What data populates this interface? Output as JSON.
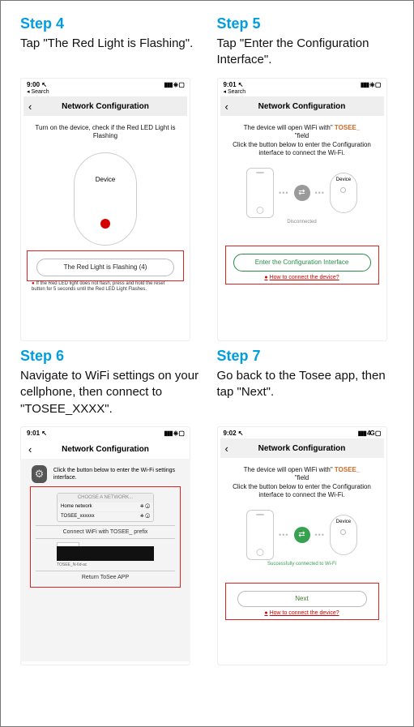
{
  "accent_blue": "#009ee0",
  "step4": {
    "title": "Step 4",
    "desc": "Tap \"The Red Light is Flashing\".",
    "status_time": "9:00",
    "status_sub": "Search",
    "status_right": "▮▮▮ ⎈ ▢",
    "nav_back": "‹",
    "nav_title": "Network Configuration",
    "instruction": "Turn on the device, check if the Red LED Light is Flashing",
    "device_label": "Device",
    "button_label": "The Red Light is Flashing (4)",
    "warn": "If the Red LED light does not flash, press and hold the reset button for 5 seconds until the Red LED Light Flashes."
  },
  "step5": {
    "title": "Step 5",
    "desc": "Tap \"Enter the Configuration Interface\".",
    "status_time": "9:01",
    "status_sub": "Search",
    "nav_title": "Network Configuration",
    "msg1": "The device will open WiFi with\" ",
    "msg_orange": "TOSEE_",
    "msg2": "\"field",
    "msg3": "Click the button below to enter the Configuration interface to connect the Wi-Fi.",
    "device_label": "Device",
    "conn_label": "Disconnected",
    "button_label": "Enter the Configuration Interface",
    "howto": "How to connect the device?"
  },
  "step6": {
    "title": "Step 6",
    "desc": "Navigate to WiFi settings on your cellphone, then connect to \"TOSEE_XXXX\".",
    "status_time": "9:01",
    "nav_title": "Network Configuration",
    "gear_text": "Click the button below to enter the Wi-Fi settings interface.",
    "wifi_hdr": "CHOOSE A NETWORK...",
    "wifi_row1": "Home network",
    "wifi_row2": "TOSEE_xxxxxx",
    "wifi_sym": "⎈  ⓘ",
    "label1": "Connect WiFi with TOSEE_ prefix",
    "ssid_sub": "TOSEE_N-6d-ac",
    "label2": "Return ToSee APP"
  },
  "step7": {
    "title": "Step 7",
    "desc": "Go back to the Tosee app, then tap \"Next\".",
    "status_time": "9:02",
    "status_right": "▮▮▮ 4G ▢",
    "nav_title": "Network Configuration",
    "msg1": "The device will open WiFi with\" ",
    "msg_orange": "TOSEE_",
    "msg2": "\"field",
    "msg3": "Click the button below to enter the Configuration interface to connect the Wi-Fi.",
    "device_label": "Device",
    "conn_label": "Successfully connected to Wi-Fi",
    "button_label": "Next",
    "howto": "How to connect the device?"
  }
}
